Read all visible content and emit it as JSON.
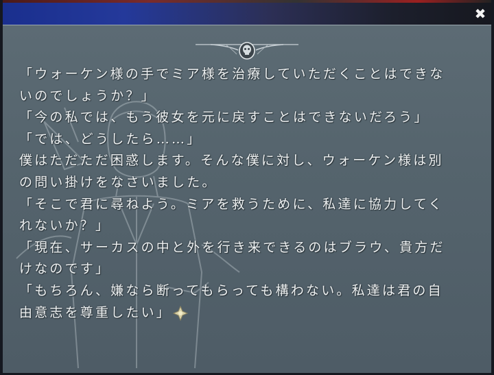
{
  "window": {
    "close_glyph": "✖"
  },
  "icons": {
    "emblem": "skull-emblem-icon",
    "wait": "cross-wait-icon",
    "close": "close-icon"
  },
  "colors": {
    "title_bar_start": "#1a2f8e",
    "panel": "#56656e",
    "text": "#eef1f2",
    "wait_icon": "#d8d1a8"
  },
  "backlog": {
    "lines": [
      "「ウォーケン様の手でミア様を治療していただくことはできな",
      "いのでしょうか？」",
      "「今の私では、もう彼女を元に戻すことはできないだろう」",
      "「では、どうしたら……」",
      "僕はただただ困惑します。そんな僕に対し、ウォーケン様は別",
      "の問い掛けをなさいました。",
      "「そこで君に尋ねよう。ミアを救うために、私達に協力してく",
      "れないか？」",
      "「現在、サーカスの中と外を行き来できるのはブラウ、貴方だ",
      "けなのです」",
      "「もちろん、嫌なら断ってもらっても構わない。私達は君の自",
      "由意志を尊重したい」"
    ]
  }
}
